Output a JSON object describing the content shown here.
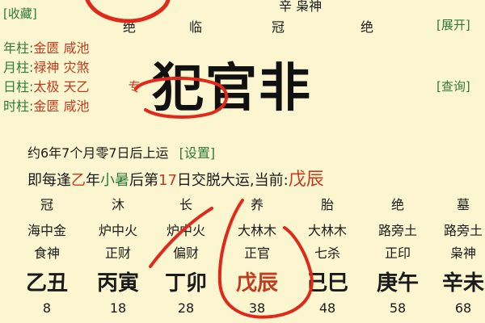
{
  "header": {
    "collect_link": "[收藏]",
    "expand_link": "[展开]",
    "query_link": "[查询]",
    "top_fragment": "辛 枭神",
    "top_stages": [
      "绝",
      "临",
      "冠",
      "绝"
    ]
  },
  "pillars": [
    {
      "label": "年柱:",
      "value": "金匮 咸池"
    },
    {
      "label": "月柱:",
      "value": "禄神 灾煞"
    },
    {
      "label": "日柱:",
      "value": "太极 天乙",
      "extra": "专"
    },
    {
      "label": "时柱:",
      "value": "金匮 咸池"
    }
  ],
  "overlay_text": "犯官非",
  "luck_start": {
    "text": "约6年7个月零7日后上运",
    "settings_link": "[设置]"
  },
  "luck_change": {
    "prefix": "即每逢",
    "stem": "乙",
    "mid": "年",
    "term": "小暑",
    "after": "后第",
    "day": "17",
    "tail": "日交脱大运,当前:",
    "current": "戊辰"
  },
  "dayun": [
    {
      "stage": "冠",
      "nayin": "海中金",
      "god": "食神",
      "ganzhi": "乙丑",
      "age": "8"
    },
    {
      "stage": "沐",
      "nayin": "炉中火",
      "god": "正财",
      "ganzhi": "丙寅",
      "age": "18"
    },
    {
      "stage": "长",
      "nayin": "炉中火",
      "god": "偏财",
      "ganzhi": "丁卯",
      "age": "28"
    },
    {
      "stage": "养",
      "nayin": "大林木",
      "god": "正官",
      "ganzhi": "戊辰",
      "age": "38",
      "current": true
    },
    {
      "stage": "胎",
      "nayin": "大林木",
      "god": "七杀",
      "ganzhi": "己巳",
      "age": "48"
    },
    {
      "stage": "绝",
      "nayin": "路旁土",
      "god": "正印",
      "ganzhi": "庚午",
      "age": "58"
    },
    {
      "stage": "墓",
      "nayin": "路旁土",
      "god": "枭神",
      "ganzhi": "辛未",
      "age": "68"
    }
  ],
  "colors": {
    "background": "#fbf6cf",
    "green": "#2f7a3a",
    "red": "#c23a1f",
    "annotation": "#e0291b"
  }
}
